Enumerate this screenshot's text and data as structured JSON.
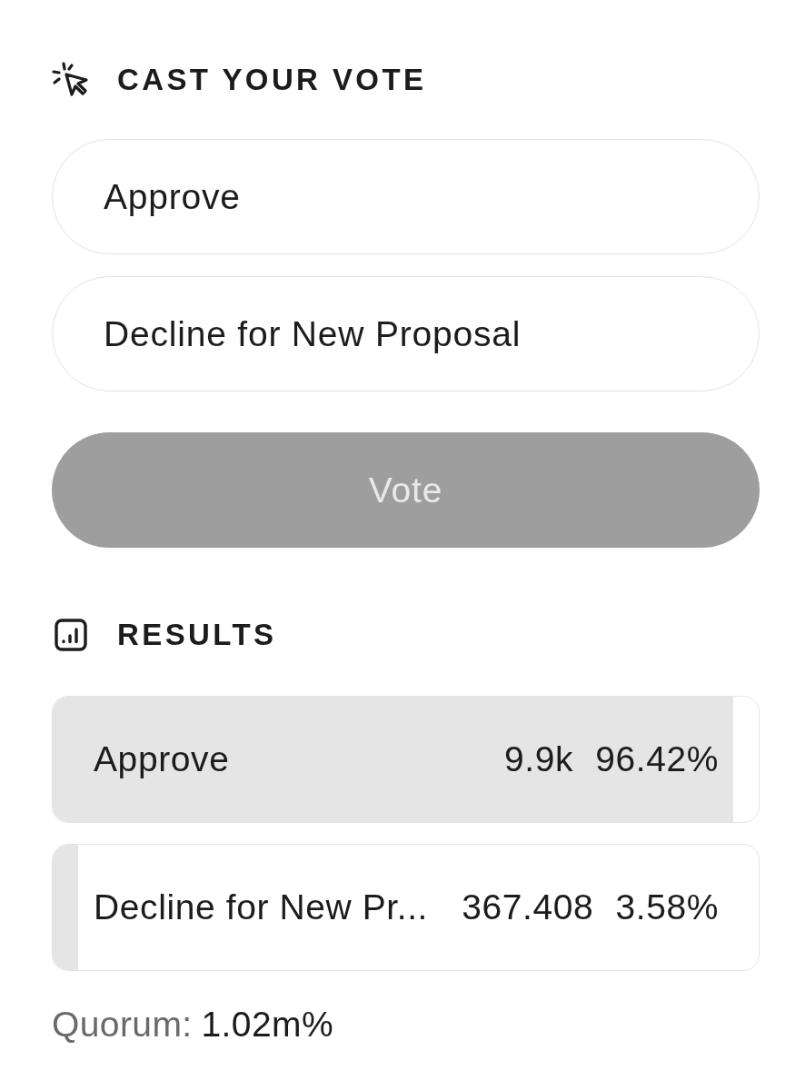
{
  "vote_section": {
    "title": "CAST YOUR VOTE",
    "options": [
      {
        "label": "Approve",
        "selected": false
      },
      {
        "label": "Decline for New Proposal",
        "selected": false
      }
    ],
    "vote_button": {
      "label": "Vote",
      "disabled": true
    }
  },
  "results_section": {
    "title": "RESULTS",
    "results": [
      {
        "label": "Approve",
        "count": "9.9k",
        "percent": "96.42%",
        "level": 0.9642
      },
      {
        "label": "Decline for New Pr...",
        "count": "367.408",
        "percent": "3.58%",
        "level": 0.0358
      }
    ]
  },
  "quorum": {
    "label": "Quorum:",
    "value": "1.02m%"
  }
}
